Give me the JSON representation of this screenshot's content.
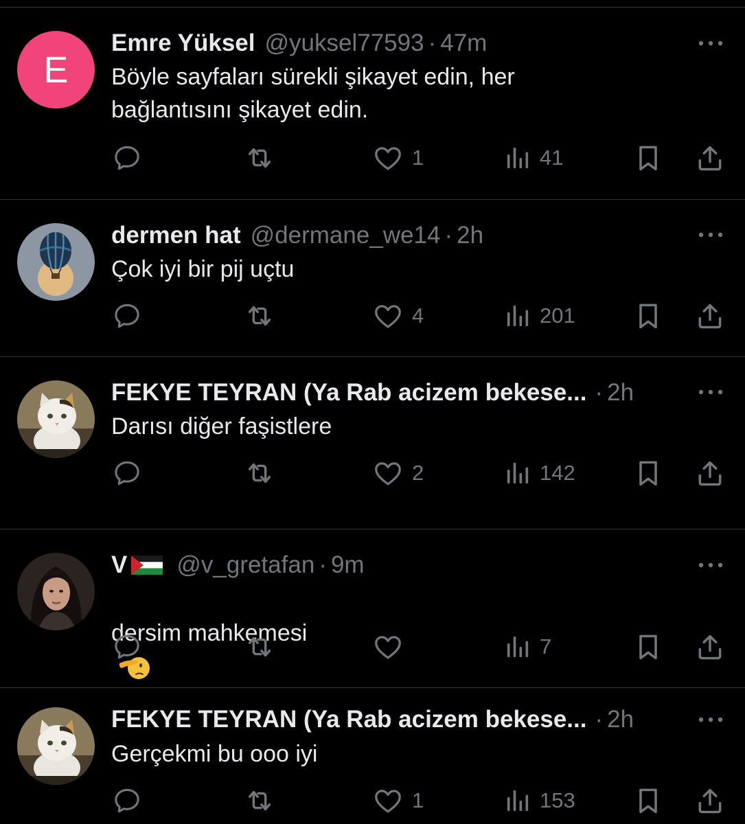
{
  "colors": {
    "background": "#000000",
    "text": "#e7e9ea",
    "muted": "#71767b",
    "divider": "#2f3336",
    "avatar_emre": "#f0447a"
  },
  "icons": {
    "more": "more-horizontal-icon",
    "reply": "reply-icon",
    "retweet": "retweet-icon",
    "like": "heart-icon",
    "views": "views-chart-icon",
    "bookmark": "bookmark-icon",
    "share": "share-icon"
  },
  "tweets": [
    {
      "avatar_letter": "E",
      "name": "Emre Yüksel",
      "handle": "@yuksel77593",
      "separator": "·",
      "time": "47m",
      "text": "Böyle sayfaları sürekli şikayet edin, her\nbağlantısını şikayet edin.",
      "likes": "1",
      "views": "41"
    },
    {
      "name": "dermen hat",
      "handle": "@dermane_we14",
      "separator": "·",
      "time": "2h",
      "text": "Çok iyi bir pij uçtu",
      "likes": "4",
      "views": "201"
    },
    {
      "name": "FEKYE TEYRAN (Ya Rab acizem bekese...",
      "handle": "",
      "separator": "·",
      "time": "2h",
      "text": "Darısı diğer faşistlere",
      "likes": "2",
      "views": "142"
    },
    {
      "name": "V",
      "handle": "@v_gretafan",
      "separator": "·",
      "time": "9m",
      "text": "dersim mahkemesi",
      "likes": "",
      "views": "7"
    },
    {
      "name": "FEKYE TEYRAN (Ya Rab acizem bekese...",
      "handle": "",
      "separator": "·",
      "time": "2h",
      "text": "Gerçekmi bu ooo iyi",
      "likes": "1",
      "views": "153"
    }
  ]
}
